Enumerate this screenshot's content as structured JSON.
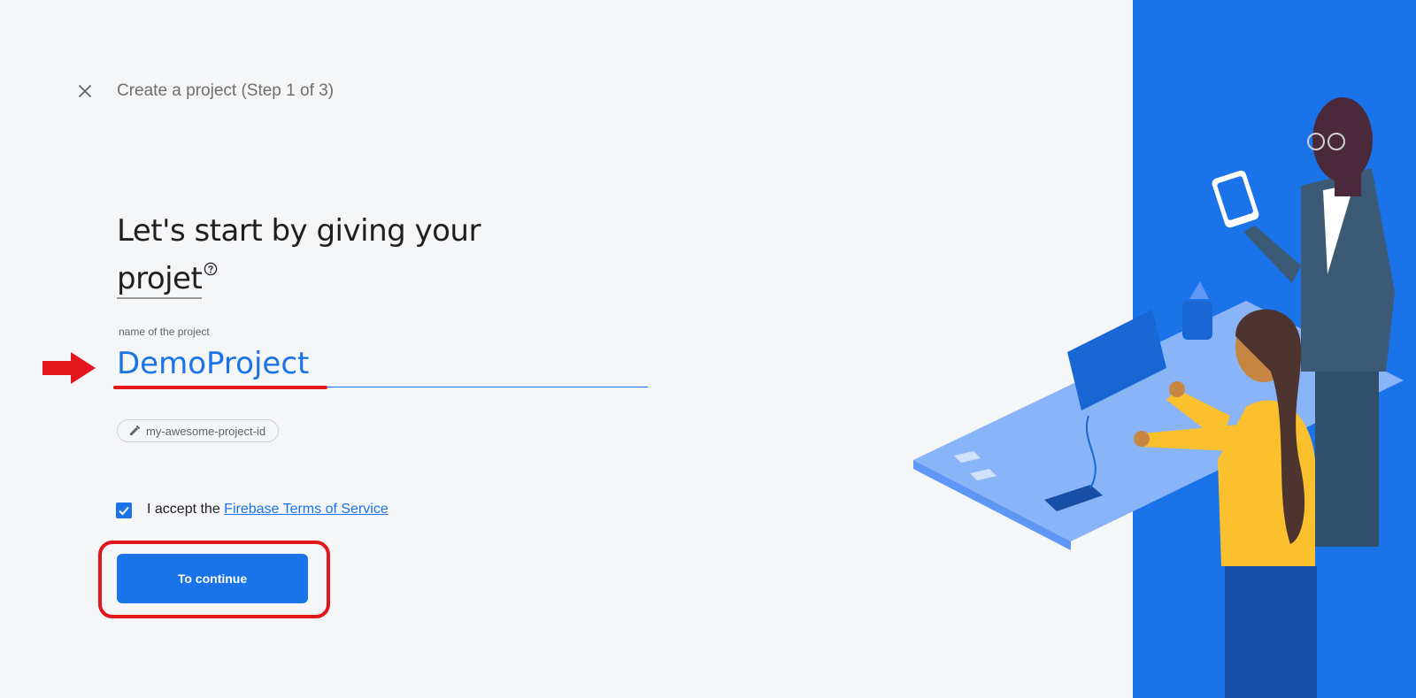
{
  "header": {
    "close_icon": "close-icon",
    "title": "Create a project (Step 1 of 3)"
  },
  "headline": {
    "line1": "Let's start by giving your",
    "line2": "projet",
    "help_icon": "help-circle-icon"
  },
  "project_name": {
    "label": "name of the project",
    "value": "DemoProject"
  },
  "project_id_chip": {
    "icon": "pencil-icon",
    "text": "my-awesome-project-id"
  },
  "terms": {
    "checked": true,
    "prefix": "I accept the ",
    "link": "Firebase Terms of Service"
  },
  "continue_button": {
    "label": "To continue"
  },
  "annotations": {
    "arrow": "red-arrow",
    "color": "#e3171b"
  },
  "colors": {
    "accent": "#1a73e8",
    "background": "#f5f6f8",
    "panel": "#1a73e8"
  }
}
